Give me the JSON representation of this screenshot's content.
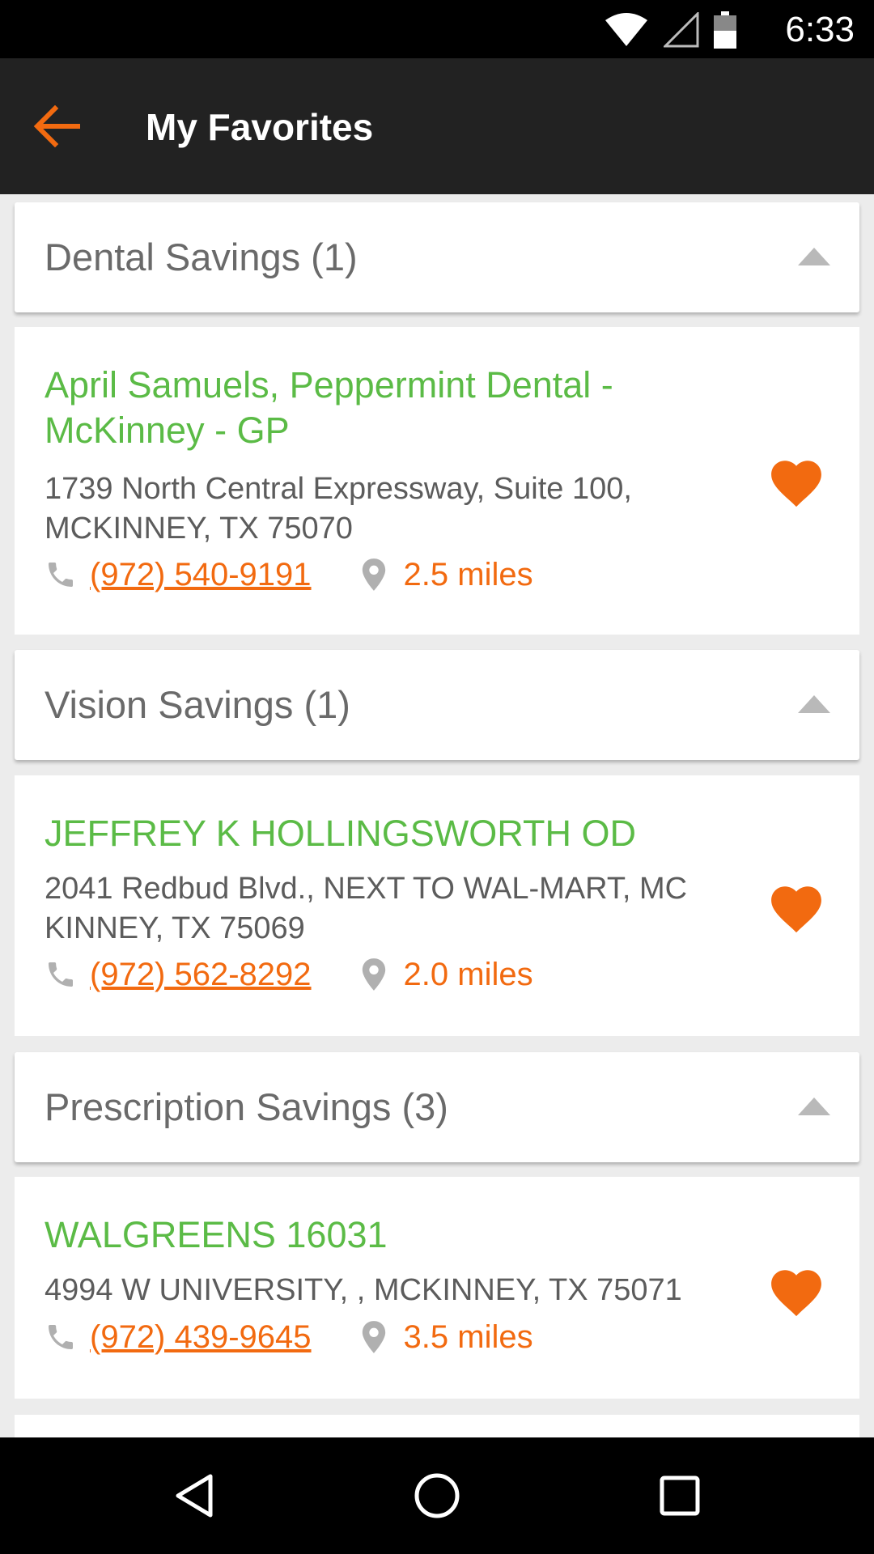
{
  "status_bar": {
    "time": "6:33",
    "icons": [
      "wifi-icon",
      "cell-signal-icon",
      "battery-icon"
    ]
  },
  "app_bar": {
    "back_icon": "arrow-left-icon",
    "title": "My Favorites"
  },
  "colors": {
    "accent": "#f26a10",
    "provider_name": "#5bbb46",
    "app_bar": "#222222"
  },
  "sections": [
    {
      "header": "Dental Savings (1)",
      "items": [
        {
          "name": "April Samuels, Peppermint Dental - McKinney - GP",
          "address_line1": "1739 North Central Expressway, Suite 100,",
          "address_line2": "MCKINNEY, TX 75070",
          "phone": "(972) 540-9191",
          "distance": "2.5 miles"
        }
      ]
    },
    {
      "header": "Vision Savings (1)",
      "items": [
        {
          "name": "JEFFREY K HOLLINGSWORTH  OD",
          "address_line1": "2041 Redbud Blvd., NEXT TO WAL-MART, MC",
          "address_line2": "KINNEY, TX 75069",
          "phone": "(972) 562-8292",
          "distance": "2.0 miles"
        }
      ]
    },
    {
      "header": "Prescription Savings (3)",
      "items": [
        {
          "name": "WALGREENS 16031",
          "address_line1": "4994 W UNIVERSITY, , MCKINNEY, TX 75071",
          "address_line2": "",
          "phone": "(972) 439-9645",
          "distance": "3.5 miles"
        }
      ]
    }
  ],
  "nav_bar": {
    "icons": [
      "back-triangle-icon",
      "home-circle-icon",
      "recents-square-icon"
    ]
  }
}
